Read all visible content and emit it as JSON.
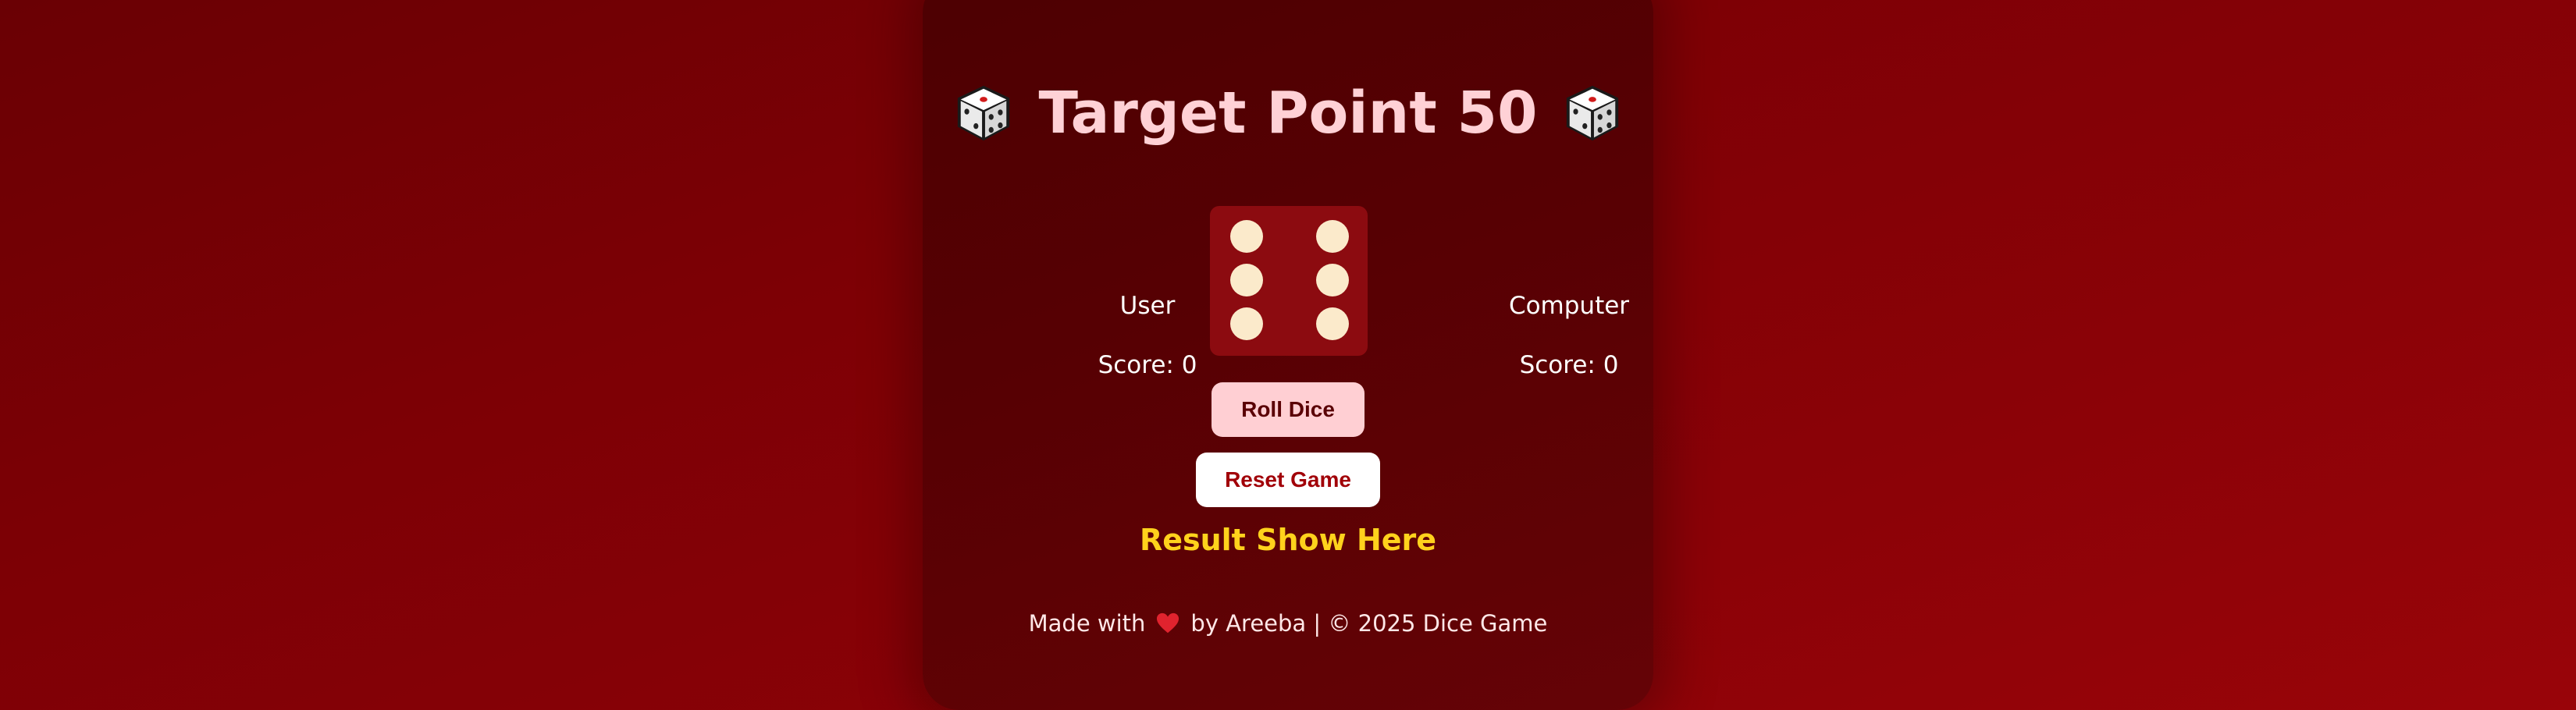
{
  "header": {
    "title": "Target Point 50",
    "left_icon": "dice-icon",
    "right_icon": "dice-icon"
  },
  "players": {
    "user": {
      "name": "User",
      "score_label": "Score: ",
      "score": 0
    },
    "computer": {
      "name": "Computer",
      "score_label": "Score: ",
      "score": 0
    }
  },
  "dice": {
    "value": 6,
    "icon": "dice-six-icon"
  },
  "controls": {
    "roll_label": "Roll Dice",
    "reset_label": "Reset Game"
  },
  "result": {
    "text": "Result Show Here"
  },
  "footer": {
    "prefix": "Made with",
    "icon": "heart-icon",
    "suffix": "by Areeba | © 2025 Dice Game"
  },
  "colors": {
    "background": "#7d0005",
    "card": "#550003",
    "title": "#ffd1d6",
    "die_face": "#8c0b10",
    "pip": "#fbeacb",
    "roll_button": "#ffcfd3",
    "reset_button": "#ffffff",
    "reset_text": "#a10008",
    "result_text": "#ffd21c",
    "heart": "#e0232e"
  }
}
